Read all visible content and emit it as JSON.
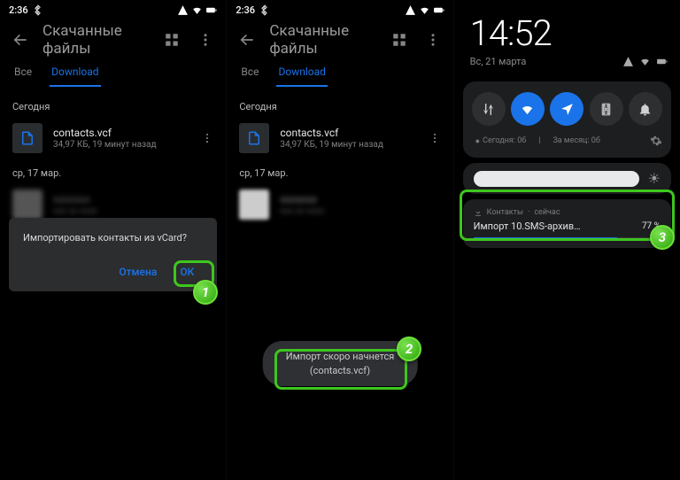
{
  "panel1": {
    "status_time": "2:36",
    "header_title": "Скачанные файлы",
    "tab_all": "Все",
    "tab_download": "Download",
    "section_today": "Сегодня",
    "file_name": "contacts.vcf",
    "file_meta": "34,97 КБ, 19 минут назад",
    "section_date": "ср, 17 мар.",
    "dialog_text": "Импортировать контакты из vCard?",
    "btn_cancel": "Отмена",
    "btn_ok": "ОК"
  },
  "panel2": {
    "status_time": "2:36",
    "header_title": "Скачанные файлы",
    "tab_all": "Все",
    "tab_download": "Download",
    "section_today": "Сегодня",
    "file_name": "contacts.vcf",
    "file_meta": "34,97 КБ, 19 минут назад",
    "section_date": "ср, 17 мар.",
    "toast_line1": "Импорт скоро начнется",
    "toast_line2": "(contacts.vcf)"
  },
  "panel3": {
    "time": "14:52",
    "date": "Вс, 21 марта",
    "counter_today": "Сегодня: 0б",
    "counter_month": "За месяц: 0б",
    "notif_app": "Контакты",
    "notif_when": "сейчас",
    "notif_title": "Импорт 10.SMS-архив…",
    "notif_pct": "77 %"
  },
  "badges": {
    "b1": "1",
    "b2": "2",
    "b3": "3"
  }
}
